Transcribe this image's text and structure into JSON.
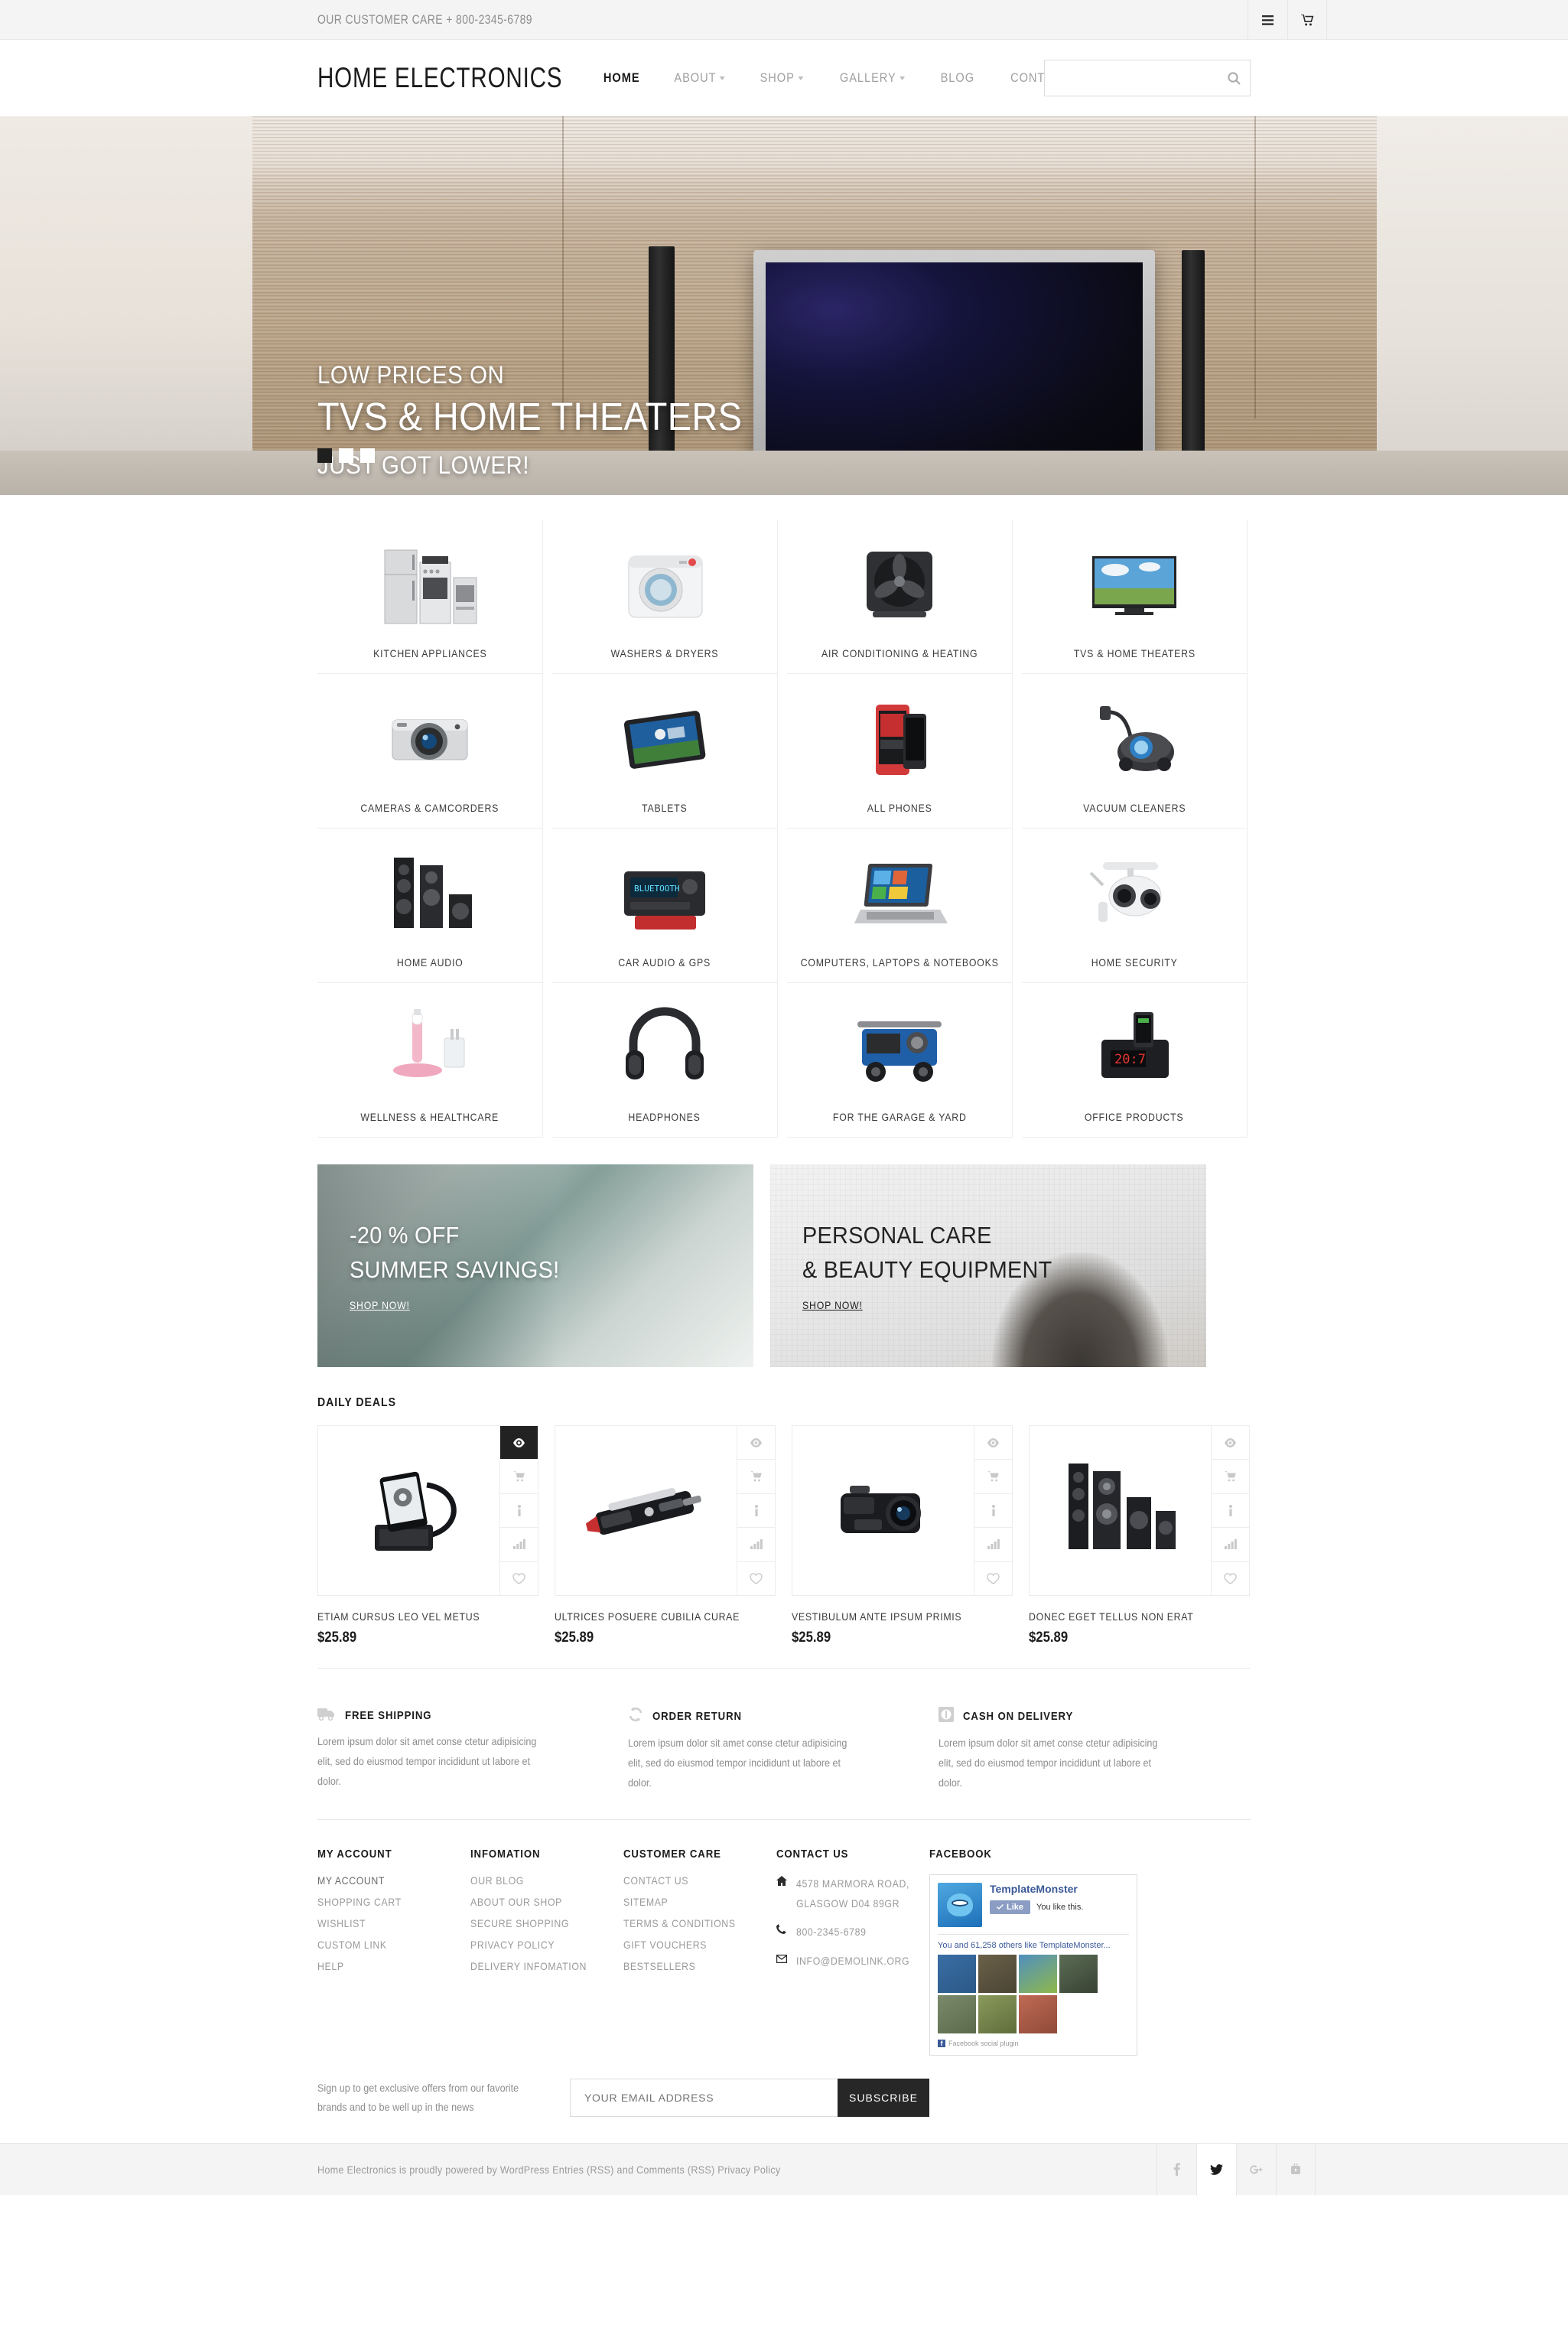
{
  "topbar": {
    "customer_care": "OUR CUSTOMER CARE  + 800-2345-6789",
    "list_icon": "list-icon",
    "cart_icon": "cart-icon"
  },
  "header": {
    "logo": "HOME ELECTRONICS",
    "nav": [
      {
        "label": "HOME",
        "active": true,
        "caret": false
      },
      {
        "label": "ABOUT",
        "active": false,
        "caret": true
      },
      {
        "label": "SHOP",
        "active": false,
        "caret": true
      },
      {
        "label": "GALLERY",
        "active": false,
        "caret": true
      },
      {
        "label": "BLOG",
        "active": false,
        "caret": false
      },
      {
        "label": "CONTACTS",
        "active": false,
        "caret": false
      }
    ],
    "search": {
      "value": "",
      "placeholder": "",
      "icon": "search-icon"
    }
  },
  "hero": {
    "line1": "LOW PRICES ON",
    "line2": "TVS & HOME THEATERS",
    "line3": "JUST GOT LOWER!",
    "slides": [
      {
        "active": true
      },
      {
        "active": false
      },
      {
        "active": false
      }
    ]
  },
  "categories": [
    {
      "label": "KITCHEN APPLIANCES",
      "icon": "fridge-stove-icon"
    },
    {
      "label": "WASHERS & DRYERS",
      "icon": "washing-machine-icon"
    },
    {
      "label": "AIR CONDITIONING & HEATING",
      "icon": "fan-icon"
    },
    {
      "label": "TVS & HOME THEATERS",
      "icon": "television-icon"
    },
    {
      "label": "CAMERAS & CAMCORDERS",
      "icon": "camera-icon"
    },
    {
      "label": "TABLETS",
      "icon": "tablet-icon"
    },
    {
      "label": "ALL PHONES",
      "icon": "smartphone-icon"
    },
    {
      "label": "VACUUM CLEANERS",
      "icon": "vacuum-cleaner-icon"
    },
    {
      "label": "HOME AUDIO",
      "icon": "speakers-icon"
    },
    {
      "label": "CAR AUDIO & GPS",
      "icon": "car-stereo-icon"
    },
    {
      "label": "COMPUTERS, LAPTOPS & NOTEBOOKS",
      "icon": "laptop-icon"
    },
    {
      "label": "HOME SECURITY",
      "icon": "security-camera-icon"
    },
    {
      "label": "WELLNESS & HEALTHCARE",
      "icon": "toothbrush-icon"
    },
    {
      "label": "HEADPHONES",
      "icon": "headphones-icon"
    },
    {
      "label": "FOR THE GARAGE & YARD",
      "icon": "generator-icon"
    },
    {
      "label": "OFFICE PRODUCTS",
      "icon": "clock-dock-icon"
    }
  ],
  "promos": [
    {
      "line1": "-20 % OFF",
      "line2": "SUMMER SAVINGS!",
      "link": "SHOP NOW!"
    },
    {
      "line1": "PERSONAL CARE",
      "line2": "& BEAUTY EQUIPMENT",
      "link": "SHOP NOW!"
    }
  ],
  "deals": {
    "title": "DAILY DEALS",
    "actions": [
      "quick-view-icon",
      "cart-icon",
      "info-icon",
      "compare-icon",
      "wishlist-heart-icon"
    ],
    "items": [
      {
        "name": "ETIAM CURSUS LEO VEL METUS",
        "price": "$25.89",
        "image": "phone-dock-icon",
        "active_action": 0
      },
      {
        "name": "ULTRICES POSUERE CUBILIA CURAE",
        "price": "$25.89",
        "image": "radar-detector-icon",
        "active_action": -1
      },
      {
        "name": "VESTIBULUM ANTE IPSUM PRIMIS",
        "price": "$25.89",
        "image": "camcorder-icon",
        "active_action": -1
      },
      {
        "name": "DONEC EGET TELLUS NON ERAT",
        "price": "$25.89",
        "image": "speaker-system-icon",
        "active_action": -1
      }
    ]
  },
  "features": [
    {
      "icon": "truck-icon",
      "title": "FREE SHIPPING",
      "text": "Lorem ipsum dolor sit amet conse ctetur adipisicing elit, sed do eiusmod tempor incididunt ut labore et dolor."
    },
    {
      "icon": "return-arrows-icon",
      "title": "ORDER RETURN",
      "text": "Lorem ipsum dolor sit amet conse ctetur adipisicing elit, sed do eiusmod tempor incididunt ut labore et dolor."
    },
    {
      "icon": "coin-icon",
      "title": "CASH ON DELIVERY",
      "text": "Lorem ipsum dolor sit amet conse ctetur adipisicing elit, sed do eiusmod tempor incididunt ut labore et dolor."
    }
  ],
  "footer": {
    "col_account": {
      "title": "MY ACCOUNT",
      "links": [
        "MY ACCOUNT",
        "SHOPPING CART",
        "WISHLIST",
        "CUSTOM LINK",
        "HELP"
      ]
    },
    "col_information": {
      "title": "INFOMATION",
      "links": [
        "OUR BLOG",
        "ABOUT OUR SHOP",
        "SECURE SHOPPING",
        "PRIVACY POLICY",
        "DELIVERY INFOMATION"
      ]
    },
    "col_care": {
      "title": "CUSTOMER CARE",
      "links": [
        "CONTACT US",
        "SITEMAP",
        "TERMS & CONDITIONS",
        "GIFT VOUCHERS",
        "BESTSELLERS"
      ]
    },
    "col_contact": {
      "title": "CONTACT US",
      "address_line1": "4578 MARMORA ROAD,",
      "address_line2": "GLASGOW D04 89GR",
      "phone": "800-2345-6789",
      "email": "INFO@DEMOLINK.ORG",
      "address_icon": "home-icon",
      "phone_icon": "phone-icon",
      "email_icon": "envelope-icon"
    },
    "col_facebook": {
      "title": "FACEBOOK",
      "page_name": "TemplateMonster",
      "like_label": "Like",
      "you_like_this": "You like this.",
      "others_prefix": "You and 61,258 others like ",
      "others_link": "TemplateMonster...",
      "plugin_label": "Facebook social plugin",
      "faces": [
        "#3a6ea5",
        "#6b6148",
        "#4f8fc0",
        "#5b6d55",
        "#7a8a6b",
        "#8a9a5b",
        "#c06a55"
      ]
    },
    "newsletter": {
      "text": "Sign up to get exclusive offers from our favorite brands and to be well up in the news",
      "placeholder": "YOUR EMAIL ADDRESS",
      "value": "",
      "button": "SUBSCRIBE"
    }
  },
  "bottombar": {
    "copyright": "Home Electronics is proudly powered by WordPress Entries (RSS) and Comments (RSS) Privacy Policy",
    "socials": [
      {
        "name": "facebook-icon",
        "highlight": false
      },
      {
        "name": "twitter-icon",
        "highlight": true
      },
      {
        "name": "google-plus-icon",
        "highlight": false
      },
      {
        "name": "youtube-icon",
        "highlight": false
      }
    ]
  }
}
